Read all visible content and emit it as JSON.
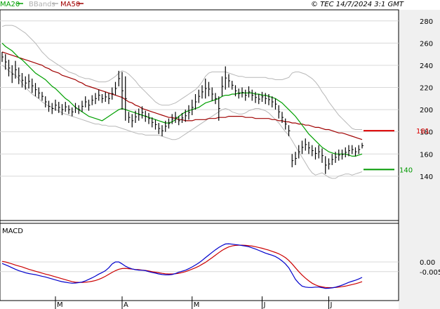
{
  "header": {
    "legend": [
      {
        "label": "MA20",
        "color": "#00a000"
      },
      {
        "label": "BBands",
        "color": "#b0b0b0"
      },
      {
        "label": "MA50",
        "color": "#a00000"
      }
    ],
    "copyright": "© TEC 14/7/2024 3:1 GMT"
  },
  "colors": {
    "price": "#000000",
    "ma20": "#00a000",
    "ma50": "#a00000",
    "bbands": "#b8b8b8",
    "grid": "#d8d8d8",
    "panel_bg": "#ffffff",
    "right_axis_bg": "#f0f0f0",
    "macd_line": "#0000cc",
    "macd_signal": "#cc0000",
    "resistance": "#dd0000",
    "support": "#009900"
  },
  "chart_data": [
    {
      "type": "line",
      "panel": "price",
      "ylim": [
        100,
        290
      ],
      "y_ticks": [
        140,
        160,
        180,
        200,
        220,
        240,
        260,
        280
      ],
      "x_labels": [
        "M",
        "A",
        "M",
        "J",
        "J"
      ],
      "x_label_index": [
        16,
        36,
        57,
        78,
        98
      ],
      "grid": true,
      "bars": [
        [
          252,
          243
        ],
        [
          250,
          236
        ],
        [
          245,
          230
        ],
        [
          240,
          224
        ],
        [
          244,
          228
        ],
        [
          238,
          223
        ],
        [
          233,
          220
        ],
        [
          230,
          218
        ],
        [
          232,
          219
        ],
        [
          228,
          215
        ],
        [
          224,
          212
        ],
        [
          220,
          210
        ],
        [
          216,
          208
        ],
        [
          212,
          202
        ],
        [
          208,
          198
        ],
        [
          206,
          196
        ],
        [
          209,
          199
        ],
        [
          207,
          197
        ],
        [
          205,
          195
        ],
        [
          207,
          198
        ],
        [
          204,
          196
        ],
        [
          202,
          194
        ],
        [
          206,
          197
        ],
        [
          204,
          196
        ],
        [
          208,
          198
        ],
        [
          212,
          202
        ],
        [
          209,
          199
        ],
        [
          213,
          204
        ],
        [
          215,
          205
        ],
        [
          218,
          208
        ],
        [
          214,
          206
        ],
        [
          216,
          207
        ],
        [
          215,
          205
        ],
        [
          220,
          209
        ],
        [
          225,
          213
        ],
        [
          235,
          221
        ],
        [
          234,
          200
        ],
        [
          230,
          190
        ],
        [
          198,
          188
        ],
        [
          196,
          184
        ],
        [
          199,
          188
        ],
        [
          201,
          190
        ],
        [
          203,
          192
        ],
        [
          199,
          189
        ],
        [
          197,
          187
        ],
        [
          193,
          184
        ],
        [
          191,
          182
        ],
        [
          188,
          178
        ],
        [
          186,
          176
        ],
        [
          190,
          180
        ],
        [
          192,
          183
        ],
        [
          196,
          187
        ],
        [
          198,
          188
        ],
        [
          194,
          186
        ],
        [
          197,
          188
        ],
        [
          200,
          189
        ],
        [
          204,
          191
        ],
        [
          209,
          195
        ],
        [
          214,
          200
        ],
        [
          218,
          206
        ],
        [
          222,
          210
        ],
        [
          228,
          210
        ],
        [
          225,
          212
        ],
        [
          220,
          208
        ],
        [
          215,
          205
        ],
        [
          212,
          190
        ],
        [
          230,
          212
        ],
        [
          239,
          218
        ],
        [
          232,
          220
        ],
        [
          226,
          218
        ],
        [
          222,
          212
        ],
        [
          219,
          210
        ],
        [
          220,
          211
        ],
        [
          218,
          208
        ],
        [
          221,
          211
        ],
        [
          218,
          208
        ],
        [
          216,
          206
        ],
        [
          214,
          205
        ],
        [
          216,
          207
        ],
        [
          215,
          205
        ],
        [
          214,
          204
        ],
        [
          212,
          202
        ],
        [
          210,
          200
        ],
        [
          204,
          192
        ],
        [
          198,
          188
        ],
        [
          192,
          182
        ],
        [
          186,
          176
        ],
        [
          160,
          148
        ],
        [
          162,
          150
        ],
        [
          168,
          156
        ],
        [
          172,
          160
        ],
        [
          174,
          163
        ],
        [
          171,
          160
        ],
        [
          168,
          158
        ],
        [
          166,
          155
        ],
        [
          168,
          156
        ],
        [
          165,
          152
        ],
        [
          158,
          142
        ],
        [
          156,
          146
        ],
        [
          160,
          150
        ],
        [
          162,
          152
        ],
        [
          164,
          154
        ],
        [
          164,
          155
        ],
        [
          166,
          157
        ],
        [
          168,
          158
        ],
        [
          168,
          160
        ],
        [
          166,
          158
        ],
        [
          168,
          160
        ],
        [
          170,
          165
        ]
      ],
      "series": [
        {
          "name": "MA20",
          "values": [
            260,
            257,
            255,
            253,
            250,
            247,
            245,
            242,
            239,
            236,
            233,
            231,
            229,
            227,
            224,
            221,
            219,
            216,
            213,
            210,
            208,
            205,
            202,
            200,
            198,
            196,
            194,
            193,
            192,
            191,
            190,
            192,
            194,
            196,
            198,
            200,
            201,
            200,
            199,
            198,
            197,
            196,
            195,
            194,
            193,
            192,
            191,
            190,
            189,
            188,
            188,
            189,
            191,
            194,
            196,
            198,
            199,
            200,
            201,
            202,
            204,
            206,
            207,
            208,
            209,
            210,
            212,
            213,
            213,
            214,
            214,
            215,
            215,
            215,
            215,
            215,
            214,
            214,
            213,
            213,
            212,
            211,
            210,
            208,
            206,
            203,
            200,
            197,
            194,
            190,
            186,
            182,
            178,
            175,
            172,
            169,
            166,
            164,
            162,
            161,
            160,
            160,
            160,
            160,
            159,
            158,
            158,
            159,
            160
          ]
        },
        {
          "name": "MA50",
          "values": [
            252,
            251,
            250,
            249,
            248,
            247,
            246,
            245,
            244,
            243,
            242,
            241,
            240,
            238,
            237,
            235,
            234,
            233,
            231,
            230,
            229,
            228,
            227,
            225,
            224,
            222,
            221,
            220,
            219,
            218,
            217,
            216,
            215,
            214,
            213,
            212,
            211,
            209,
            207,
            206,
            204,
            203,
            201,
            200,
            199,
            198,
            197,
            196,
            195,
            194,
            193,
            193,
            192,
            191,
            191,
            190,
            190,
            190,
            191,
            191,
            191,
            191,
            192,
            192,
            192,
            193,
            193,
            193,
            194,
            194,
            194,
            194,
            194,
            193,
            193,
            193,
            192,
            192,
            192,
            192,
            192,
            191,
            191,
            190,
            190,
            189,
            189,
            188,
            188,
            187,
            187,
            186,
            186,
            185,
            184,
            184,
            183,
            182,
            182,
            181,
            180,
            179,
            179,
            178,
            177,
            176,
            175,
            174,
            173
          ]
        },
        {
          "name": "BBands upper",
          "values": [
            275,
            276,
            276,
            276,
            275,
            273,
            271,
            269,
            266,
            263,
            260,
            256,
            252,
            249,
            246,
            244,
            242,
            240,
            238,
            236,
            234,
            233,
            232,
            230,
            229,
            228,
            228,
            227,
            226,
            225,
            225,
            225,
            226,
            228,
            230,
            233,
            235,
            234,
            232,
            229,
            226,
            222,
            219,
            216,
            213,
            210,
            207,
            205,
            204,
            204,
            204,
            205,
            206,
            208,
            210,
            212,
            214,
            216,
            218,
            221,
            225,
            230,
            233,
            234,
            234,
            234,
            234,
            234,
            233,
            232,
            231,
            230,
            230,
            229,
            229,
            229,
            229,
            229,
            229,
            229,
            228,
            228,
            227,
            227,
            227,
            228,
            229,
            233,
            234,
            234,
            233,
            232,
            230,
            228,
            225,
            221,
            216,
            212,
            207,
            203,
            199,
            195,
            192,
            189,
            186,
            183,
            182,
            182,
            182
          ]
        },
        {
          "name": "BBands lower",
          "values": [
            240,
            238,
            235,
            233,
            231,
            228,
            224,
            220,
            217,
            214,
            212,
            210,
            207,
            205,
            203,
            202,
            200,
            199,
            197,
            196,
            195,
            194,
            193,
            192,
            191,
            190,
            189,
            188,
            187,
            187,
            186,
            186,
            185,
            185,
            185,
            184,
            183,
            182,
            181,
            180,
            179,
            178,
            178,
            177,
            177,
            177,
            177,
            177,
            176,
            175,
            174,
            173,
            173,
            174,
            176,
            178,
            180,
            182,
            184,
            186,
            188,
            190,
            192,
            194,
            196,
            198,
            200,
            201,
            200,
            198,
            197,
            196,
            196,
            197,
            199,
            200,
            201,
            201,
            200,
            199,
            197,
            194,
            191,
            188,
            184,
            180,
            177,
            172,
            167,
            162,
            157,
            152,
            147,
            143,
            141,
            142,
            143,
            141,
            139,
            138,
            138,
            140,
            141,
            142,
            142,
            141,
            142,
            143,
            144
          ]
        }
      ],
      "annotations": [
        {
          "label": "181",
          "value": 181,
          "color": "#dd0000"
        },
        {
          "label": "140",
          "value": 146,
          "color": "#009900"
        }
      ]
    },
    {
      "type": "line",
      "panel": "macd",
      "title": "MACD",
      "ylim": [
        -0.02,
        0.02
      ],
      "y_ticks": [
        0,
        -0.005
      ],
      "y_tick_labels": [
        "0.00",
        "-0.005"
      ],
      "series": [
        {
          "name": "MACD",
          "values": [
            -0.0008,
            -0.0015,
            -0.0022,
            -0.003,
            -0.0038,
            -0.0045,
            -0.005,
            -0.0056,
            -0.006,
            -0.0063,
            -0.0066,
            -0.007,
            -0.0074,
            -0.0078,
            -0.0083,
            -0.0088,
            -0.0093,
            -0.0098,
            -0.0102,
            -0.0105,
            -0.0108,
            -0.011,
            -0.0109,
            -0.0107,
            -0.0104,
            -0.0098,
            -0.009,
            -0.0082,
            -0.0073,
            -0.0063,
            -0.0055,
            -0.0045,
            -0.003,
            -0.001,
            0.0,
            0.0,
            -0.001,
            -0.0022,
            -0.003,
            -0.0036,
            -0.004,
            -0.0042,
            -0.0043,
            -0.0045,
            -0.005,
            -0.0055,
            -0.0058,
            -0.0062,
            -0.0065,
            -0.0067,
            -0.0067,
            -0.0065,
            -0.006,
            -0.0053,
            -0.0048,
            -0.0043,
            -0.0035,
            -0.0026,
            -0.0016,
            -0.0005,
            0.0008,
            0.0022,
            0.0036,
            0.005,
            0.0063,
            0.0075,
            0.0085,
            0.0093,
            0.0094,
            0.0092,
            0.009,
            0.0088,
            0.0085,
            0.0082,
            0.0079,
            0.0073,
            0.0067,
            0.006,
            0.0053,
            0.0046,
            0.004,
            0.0035,
            0.0028,
            0.0018,
            0.0005,
            -0.001,
            -0.003,
            -0.006,
            -0.009,
            -0.011,
            -0.0125,
            -0.013,
            -0.0132,
            -0.0132,
            -0.013,
            -0.013,
            -0.0133,
            -0.0137,
            -0.0136,
            -0.0134,
            -0.0131,
            -0.0126,
            -0.012,
            -0.0113,
            -0.0106,
            -0.01,
            -0.0095,
            -0.0088,
            -0.008
          ]
        },
        {
          "name": "Signal",
          "values": [
            0.0003,
            0.0,
            -0.0005,
            -0.001,
            -0.0016,
            -0.0021,
            -0.0026,
            -0.0032,
            -0.0038,
            -0.0043,
            -0.0048,
            -0.0053,
            -0.0058,
            -0.0063,
            -0.0067,
            -0.0072,
            -0.0077,
            -0.0082,
            -0.0087,
            -0.0092,
            -0.0097,
            -0.0102,
            -0.0105,
            -0.0106,
            -0.0106,
            -0.0105,
            -0.0103,
            -0.01,
            -0.0096,
            -0.009,
            -0.0083,
            -0.0074,
            -0.0064,
            -0.0054,
            -0.0045,
            -0.0038,
            -0.0034,
            -0.0033,
            -0.0035,
            -0.0037,
            -0.0039,
            -0.004,
            -0.0042,
            -0.0044,
            -0.0047,
            -0.005,
            -0.0053,
            -0.0056,
            -0.0059,
            -0.0061,
            -0.0062,
            -0.0062,
            -0.0061,
            -0.0059,
            -0.0055,
            -0.005,
            -0.0044,
            -0.0037,
            -0.003,
            -0.0022,
            -0.0012,
            -0.0002,
            0.001,
            0.0022,
            0.0035,
            0.0048,
            0.006,
            0.007,
            0.0078,
            0.0083,
            0.0086,
            0.0087,
            0.0087,
            0.0086,
            0.0084,
            0.0082,
            0.0079,
            0.0075,
            0.0071,
            0.0066,
            0.0061,
            0.0055,
            0.0049,
            0.0042,
            0.0033,
            0.0022,
            0.0008,
            -0.001,
            -0.003,
            -0.005,
            -0.0068,
            -0.0084,
            -0.0098,
            -0.011,
            -0.0119,
            -0.0125,
            -0.0129,
            -0.0132,
            -0.0133,
            -0.0133,
            -0.0132,
            -0.013,
            -0.0128,
            -0.0125,
            -0.0121,
            -0.0117,
            -0.0113,
            -0.0108,
            -0.0102
          ]
        }
      ]
    }
  ]
}
